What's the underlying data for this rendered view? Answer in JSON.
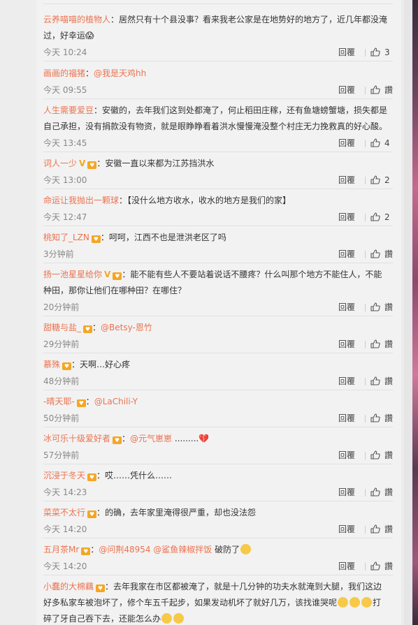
{
  "colors": {
    "username": "#eb7350",
    "text": "#333333",
    "meta": "#888888",
    "page_bg": "#f2f2f2"
  },
  "comments": [
    {
      "user": "云养喵喵的植物人",
      "text": "：居然只有十个县没事？看来我老公家是在地势好的地方了，近几年都没淹",
      "text2": "过，好幸运😱",
      "time": "今天 10:24",
      "reply": "回覆",
      "likes": "3"
    },
    {
      "user": "画画的福猪",
      "text": "：",
      "mention": "@我是天鸡hh",
      "time": "今天 09:55",
      "reply": "回覆",
      "likes": "讚"
    },
    {
      "user": "人生需要爱豆",
      "text": "：安徽的，去年我们这到处都淹了，何止稻田庄稼，还有鱼塘螃蟹塘，损失都是",
      "text2": "自己承担，没有捐款没有物资，就是眼睁睁看着洪水慢慢淹没整个村庄无力挽救真的好心酸。",
      "time": "今天 13:45",
      "reply": "回覆",
      "likes": "4"
    },
    {
      "user": "词人一少",
      "text": "：安徽一直以来都为江苏挡洪水",
      "time": "今天 13:00",
      "reply": "回覆",
      "likes": "2"
    },
    {
      "user": "命运让我抛出一颗球",
      "text": "：【没什么地方收水，收水的地方是我们的家】",
      "time": "今天 12:47",
      "reply": "回覆",
      "likes": "2"
    },
    {
      "user": "桃知了_LZN",
      "text": "：呵呵，江西不也是泄洪老区了吗",
      "time": "3分钟前",
      "reply": "回覆",
      "likes": "讚"
    },
    {
      "user": "扬一池星星给你",
      "text": "：能不能有些人不要站着说话不腰疼？什么叫那个地方不能住人，不能",
      "text2": "种田，那你让他们在哪种田？在哪住？",
      "time": "20分钟前",
      "reply": "回覆",
      "likes": "讚"
    },
    {
      "user": "甜糖与盐_",
      "text": "：",
      "mention": "@Betsy-恩竹",
      "time": "29分钟前",
      "reply": "回覆",
      "likes": "讚"
    },
    {
      "user": "慕殊",
      "text": "：天啊…好心疼",
      "time": "48分钟前",
      "reply": "回覆",
      "likes": "讚"
    },
    {
      "user": "-晴天耶-",
      "text": "：",
      "mention": "@LaChili-Y",
      "time": "50分钟前",
      "reply": "回覆",
      "likes": "讚"
    },
    {
      "user": "冰可乐十级爱好者",
      "text": "：",
      "mention": "@元气崽崽",
      "text_after": " .........💔",
      "time": "57分钟前",
      "reply": "回覆",
      "likes": "讚"
    },
    {
      "user": "沉浸于冬天",
      "text": "：哎……凭什么……",
      "time": "今天 14:23",
      "reply": "回覆",
      "likes": "讚"
    },
    {
      "user": "菜菜不太行",
      "text": "：的确，去年家里淹得很严重，却也没法怨",
      "time": "今天 14:20",
      "reply": "回覆",
      "likes": "讚"
    },
    {
      "user": "五月茶Mr",
      "text": "：",
      "mention": "@问荆48954 @鲨鱼辣椒拌饭",
      "text_after": " 破防了",
      "time": "今天 14:20",
      "reply": "回覆",
      "likes": "讚"
    },
    {
      "user": "小蠢的大棉藕",
      "text": "：去年我家在市区都被淹了，就是十几分钟的功夫水就淹到大腿，我们这边",
      "text2": "好多私家车被泡坏了，修个车五千起步，如果发动机坏了就好几万，该找谁哭呢",
      "text3": "打",
      "text4": "碎了牙自己吞下去，还能怎么办"
    }
  ]
}
